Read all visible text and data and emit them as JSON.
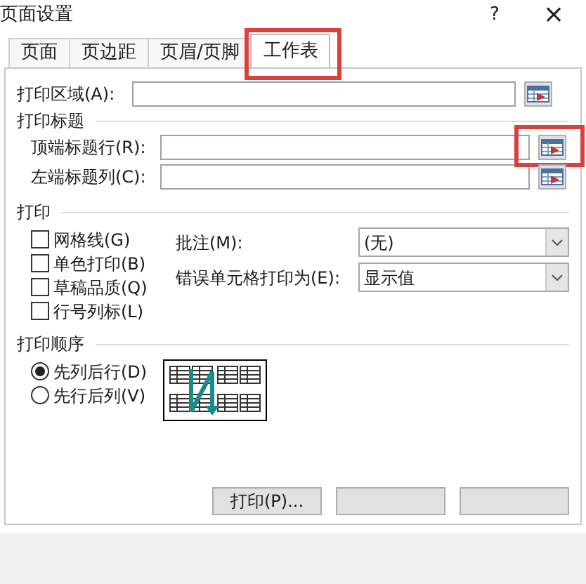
{
  "window": {
    "title": "页面设置",
    "help": "?",
    "close": "×"
  },
  "tabs": [
    {
      "label": "页面",
      "selected": false,
      "highlighted": false
    },
    {
      "label": "页边距",
      "selected": false,
      "highlighted": false
    },
    {
      "label": "页眉/页脚",
      "selected": false,
      "highlighted": false
    },
    {
      "label": "工作表",
      "selected": true,
      "highlighted": true
    }
  ],
  "print_area": {
    "label": "打印区域(A):",
    "highlighted": false
  },
  "print_titles": {
    "heading": "打印标题",
    "rows": [
      {
        "label": "顶端标题行(R):",
        "highlighted": true
      },
      {
        "label": "左端标题列(C):",
        "highlighted": false
      }
    ]
  },
  "print": {
    "heading": "打印",
    "checkboxes": [
      {
        "label": "网格线(G)",
        "checked": false
      },
      {
        "label": "单色打印(B)",
        "checked": false
      },
      {
        "label": "草稿品质(Q)",
        "checked": false
      },
      {
        "label": "行号列标(L)",
        "checked": false
      }
    ],
    "selects": [
      {
        "label": "批注(M):",
        "value": "(无)"
      },
      {
        "label": "错误单元格打印为(E):",
        "value": "显示值"
      }
    ]
  },
  "page_order": {
    "heading": "打印顺序",
    "options": [
      {
        "label": "先列后行(D)",
        "selected": true
      },
      {
        "label": "先行后列(V)",
        "selected": false
      }
    ]
  },
  "buttons": [
    {
      "kind": "labeled",
      "label": "打印(P)..."
    },
    {
      "kind": "blank"
    },
    {
      "kind": "blank"
    }
  ]
}
